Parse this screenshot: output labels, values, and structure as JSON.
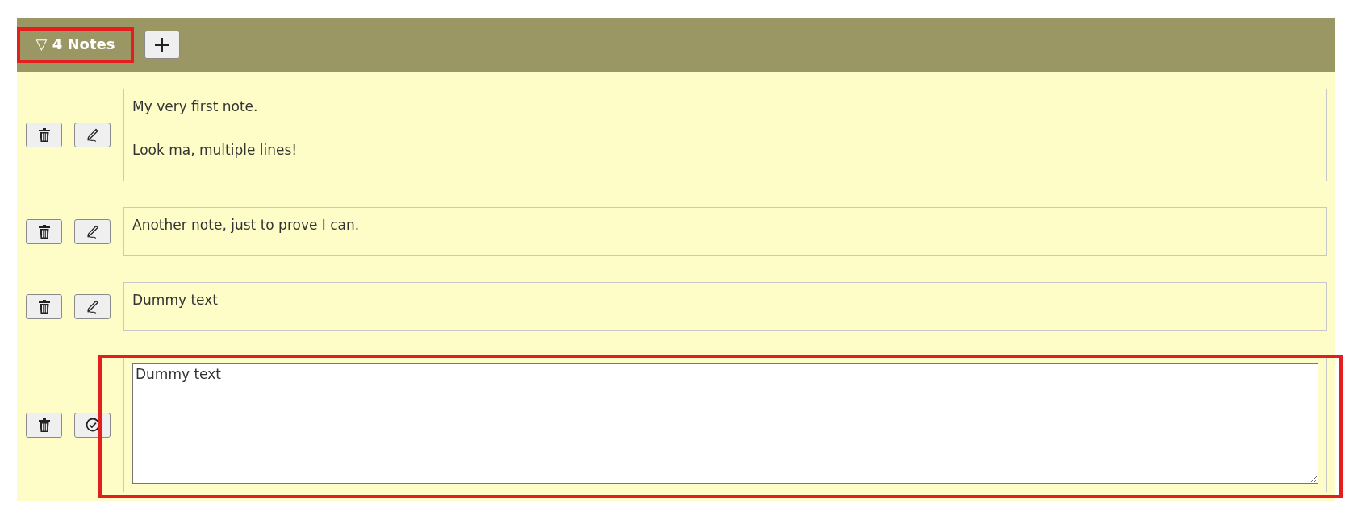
{
  "notes_panel": {
    "toggle": {
      "label": "▽ 4 Notes",
      "highlighted": true
    },
    "notes": [
      {
        "text": "My very first note.\n\nLook ma, multiple lines!",
        "editing": false,
        "highlighted": false
      },
      {
        "text": "Another note, just to prove I can.",
        "editing": false,
        "highlighted": false
      },
      {
        "text": "Dummy text",
        "editing": false,
        "highlighted": false
      },
      {
        "text": "Dummy text",
        "editing": true,
        "highlighted": true
      }
    ]
  }
}
